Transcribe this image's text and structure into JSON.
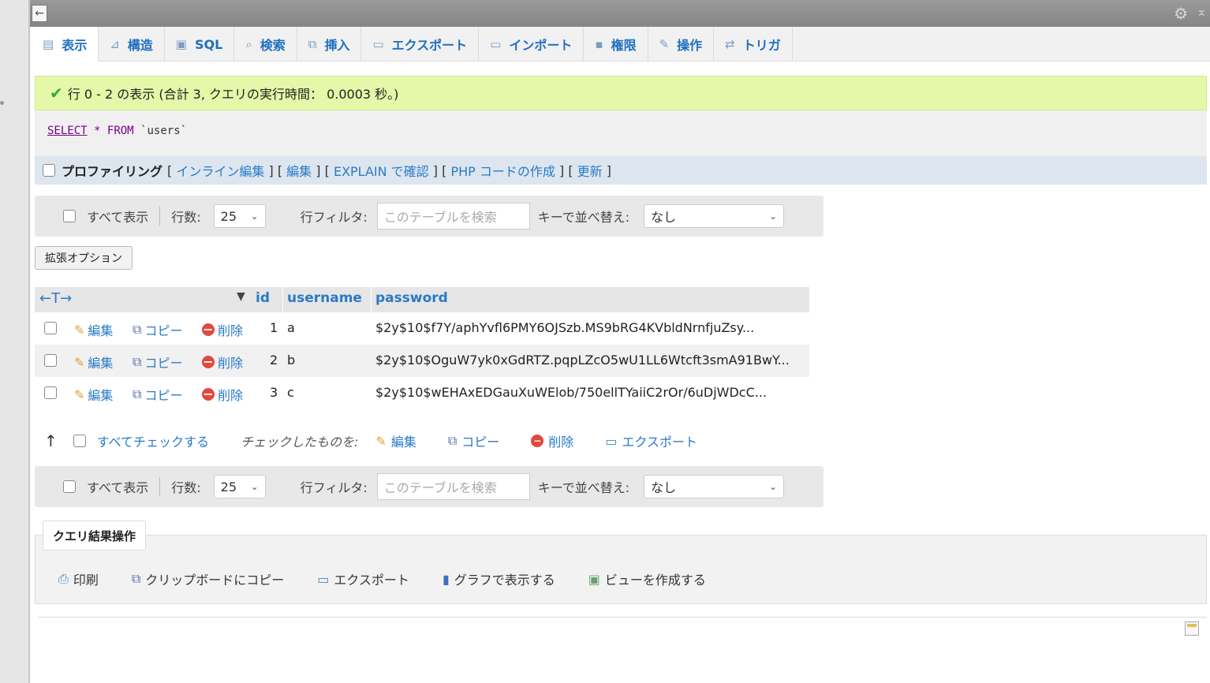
{
  "window": {
    "back_arrow": "←",
    "gear": "⚙",
    "collapse": "⌅"
  },
  "tabs": [
    {
      "icon": "▤",
      "label": "表示"
    },
    {
      "icon": "⊿",
      "label": "構造"
    },
    {
      "icon": "▣",
      "label": "SQL"
    },
    {
      "icon": "⌕",
      "label": "検索"
    },
    {
      "icon": "⧉",
      "label": "挿入"
    },
    {
      "icon": "▭",
      "label": "エクスポート"
    },
    {
      "icon": "▭",
      "label": "インポート"
    },
    {
      "icon": "▪",
      "label": "権限"
    },
    {
      "icon": "✎",
      "label": "操作"
    },
    {
      "icon": "⇄",
      "label": "トリガ"
    }
  ],
  "success": {
    "check": "✔",
    "message": "行 0 - 2 の表示 (合計 3, クエリの実行時間： 0.0003 秒。)"
  },
  "sql": {
    "select": "SELECT",
    "star": "*",
    "from": "FROM",
    "table": "`users`"
  },
  "profiling": {
    "label": "プロファイリング",
    "links": [
      "インライン編集",
      "編集",
      "EXPLAIN で確認",
      "PHP コードの作成",
      "更新"
    ],
    "lb": "[",
    "rb": "]"
  },
  "nav": {
    "show_all": "すべて表示",
    "rows_label": "行数:",
    "rows_value": "25",
    "filter_label": "行フィルタ:",
    "filter_placeholder": "このテーブルを検索",
    "sort_label": "キーで並べ替え:",
    "sort_value": "なし"
  },
  "ext_options": "拡張オプション",
  "table": {
    "arrows": "←T→",
    "sort_indicator": "▼",
    "headers": {
      "id": "id",
      "username": "username",
      "password": "password"
    },
    "actions": {
      "edit": "編集",
      "copy": "コピー",
      "delete": "削除"
    },
    "rows": [
      {
        "id": "1",
        "username": "a",
        "password": "$2y$10$f7Y/aphYvfl6PMY6OJSzb.MS9bRG4KVbldNrnfjuZsy..."
      },
      {
        "id": "2",
        "username": "b",
        "password": "$2y$10$OguW7yk0xGdRTZ.pqpLZcO5wU1LL6Wtcft3smA91BwY..."
      },
      {
        "id": "3",
        "username": "c",
        "password": "$2y$10$wEHAxEDGauXuWElob/750ellTYaiiC2rOr/6uDjWDcC..."
      }
    ]
  },
  "bulk": {
    "up_arrow": "↑",
    "check_all": "すべてチェックする",
    "with_selected": "チェックしたものを:",
    "edit": "編集",
    "copy": "コピー",
    "delete": "削除",
    "export": "エクスポート"
  },
  "query_results": {
    "legend": "クエリ結果操作",
    "print": "印刷",
    "copy_clipboard": "クリップボードにコピー",
    "export": "エクスポート",
    "chart": "グラフで表示する",
    "create_view": "ビューを作成する"
  },
  "icons": {
    "pencil": "✎",
    "copy": "⧉",
    "delete": "−",
    "export": "▭",
    "print": "⎙",
    "chart": "▮",
    "view": "▣"
  }
}
